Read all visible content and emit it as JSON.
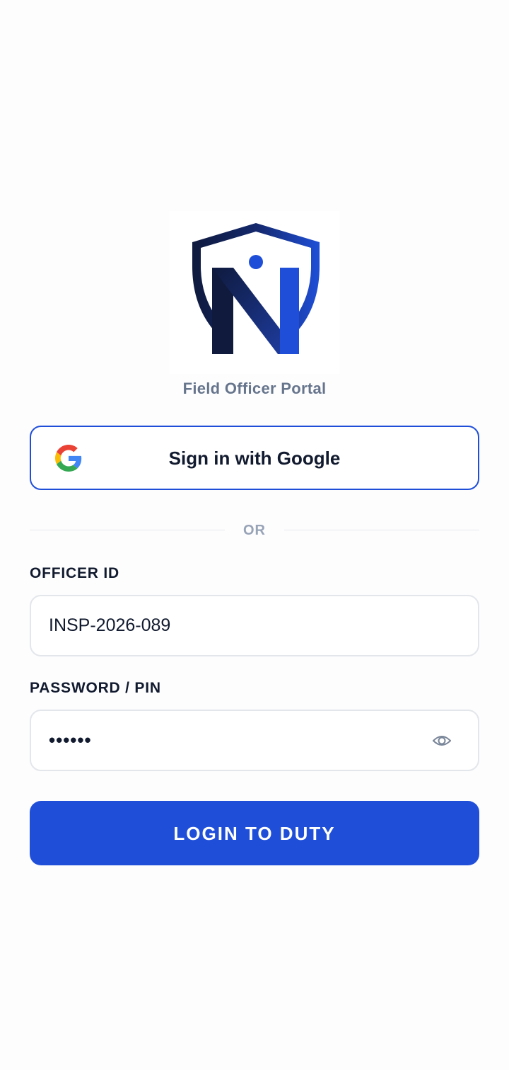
{
  "brand": {
    "logo": "shield-n-logo",
    "subtitle": "Field Officer Portal",
    "colors": {
      "navy": "#0f1a3d",
      "accent": "#1f4fd8"
    }
  },
  "google_signin": {
    "label": "Sign in with Google",
    "icon": "google-icon"
  },
  "divider": {
    "text": "OR"
  },
  "officer_id": {
    "label": "OFFICER ID",
    "value": "INSP-2026-089"
  },
  "password": {
    "label": "PASSWORD / PIN",
    "value": "••••••",
    "toggle_icon": "eye-icon"
  },
  "login_button": {
    "label": "LOGIN TO DUTY",
    "color": "#1f4fd8"
  }
}
